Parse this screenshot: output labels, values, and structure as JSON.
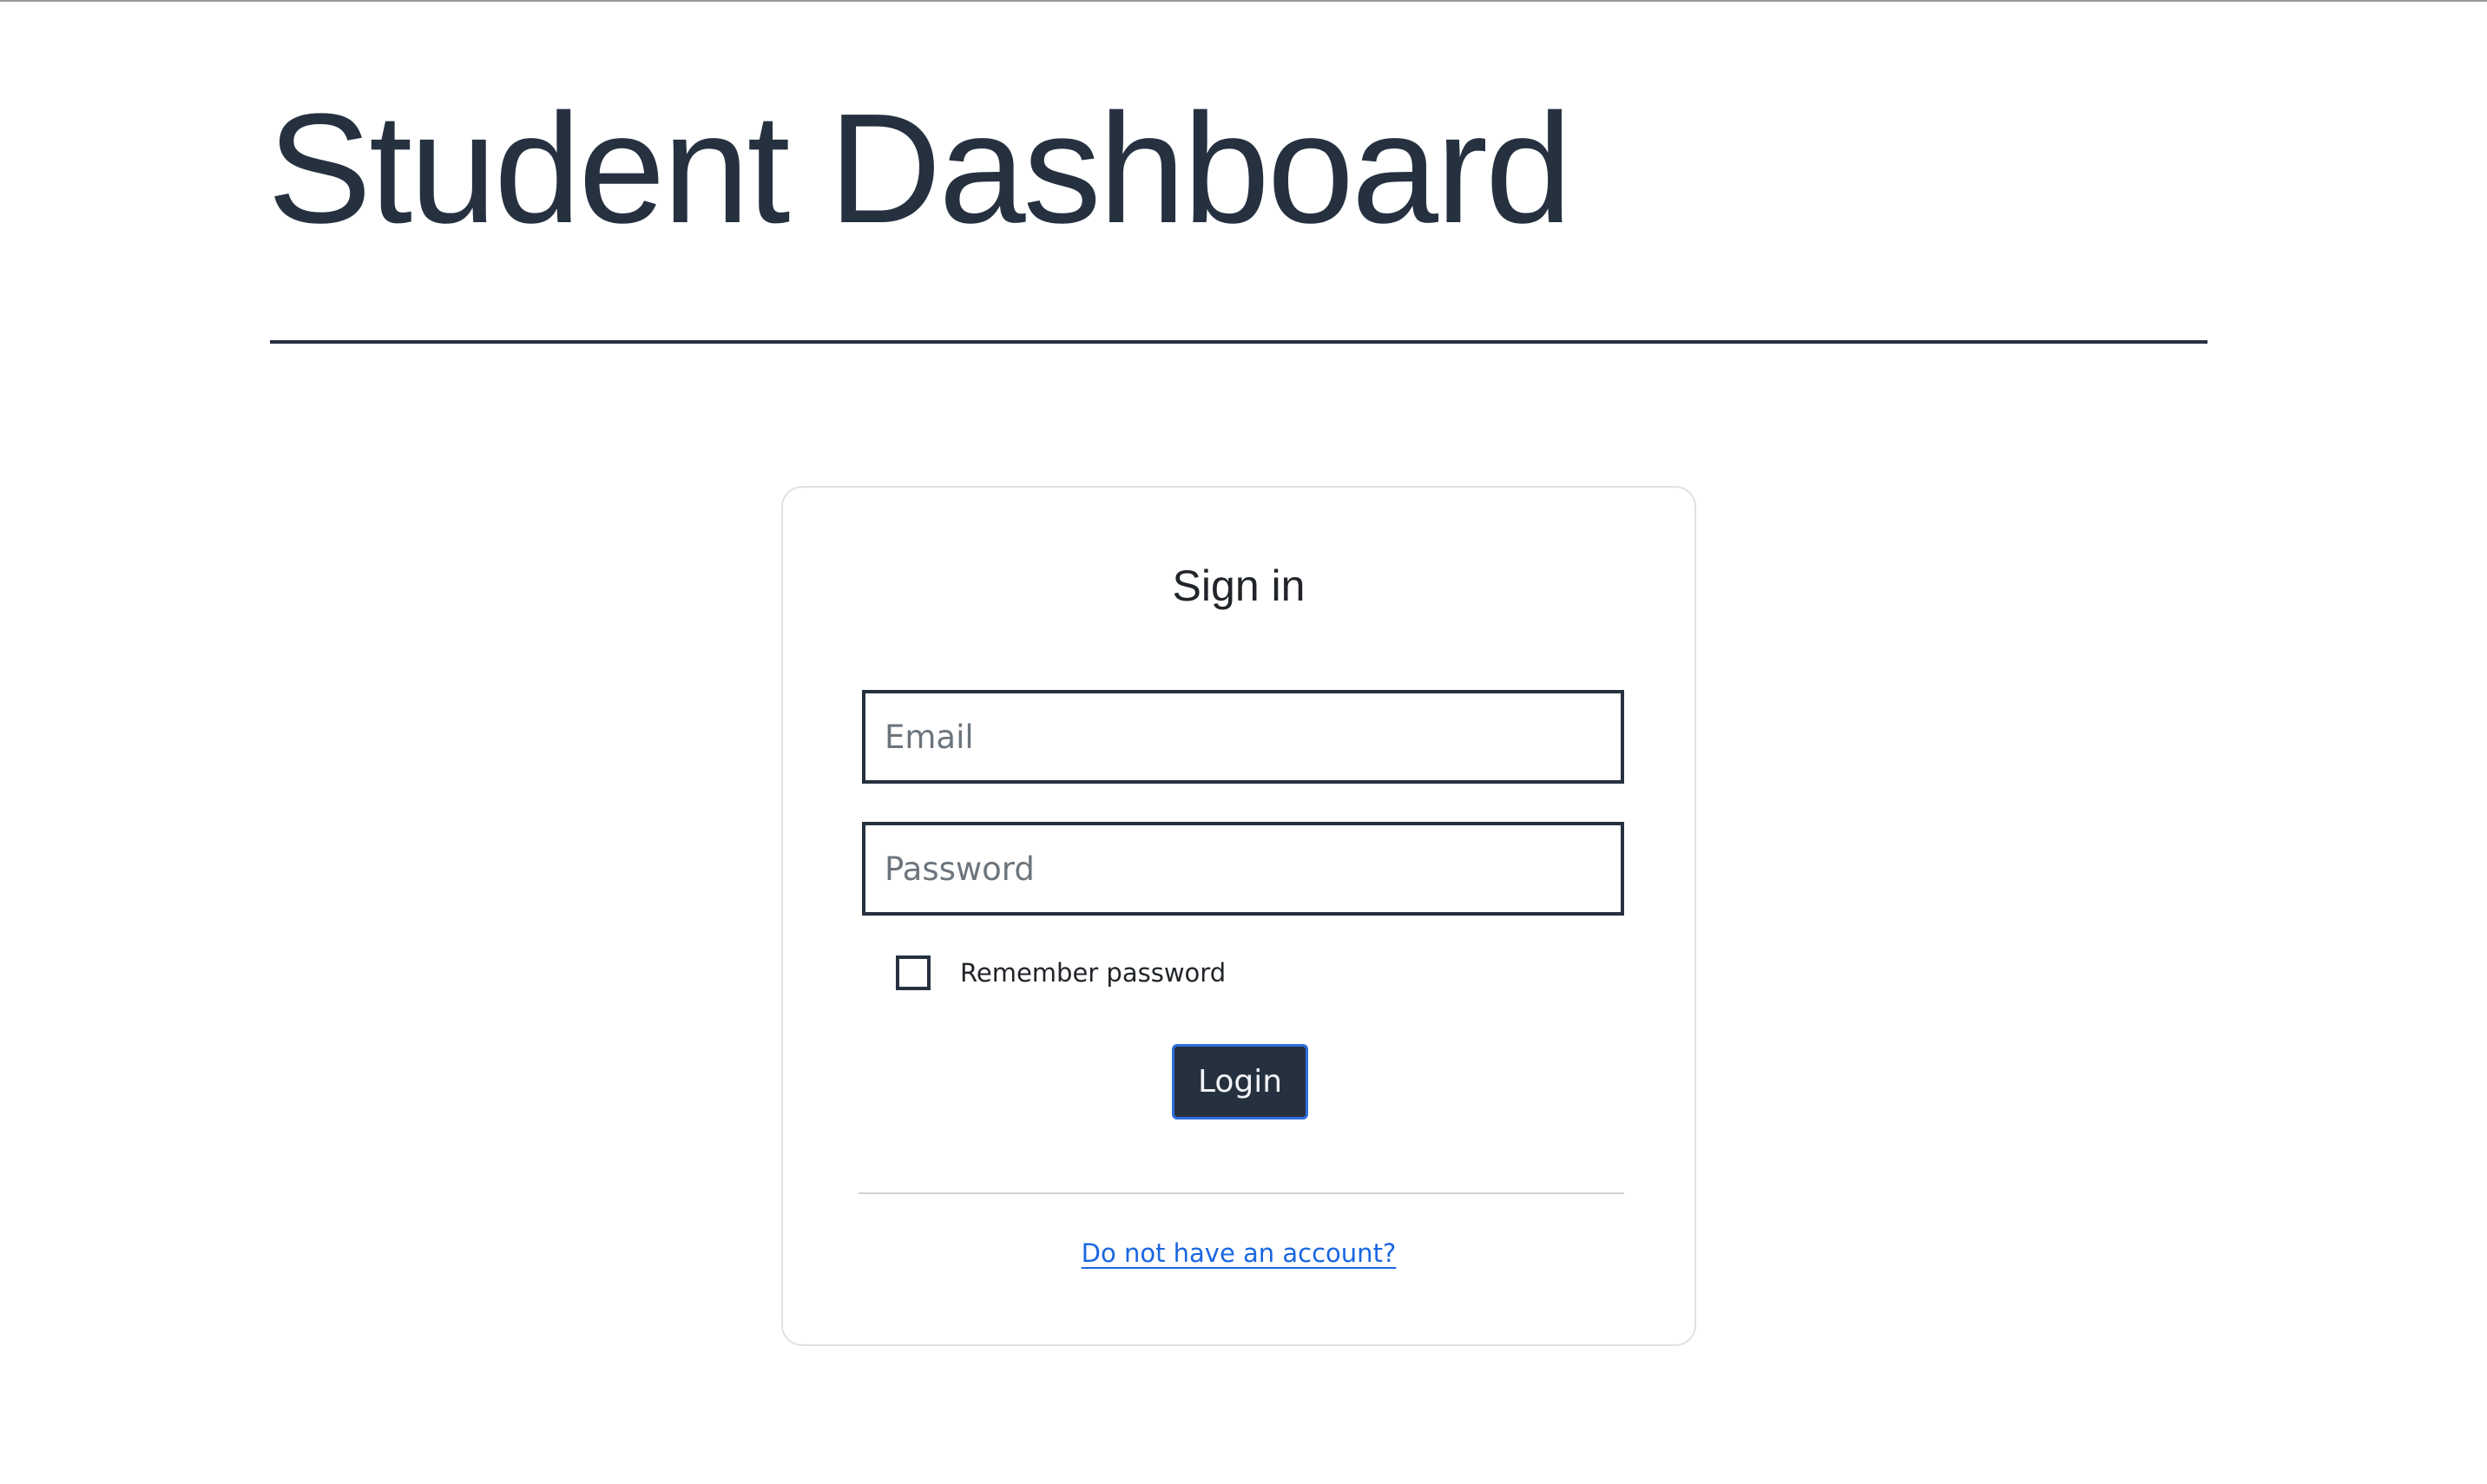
{
  "header": {
    "title": "Student Dashboard"
  },
  "signin": {
    "title": "Sign in",
    "email_placeholder": "Email",
    "password_placeholder": "Password",
    "remember_label": "Remember password",
    "login_label": "Login",
    "signup_link": "Do not have an account?"
  },
  "colors": {
    "primary_dark": "#263140",
    "link": "#1a66e0",
    "button_border": "#2f6fe0",
    "card_border": "#dfe2e6"
  }
}
